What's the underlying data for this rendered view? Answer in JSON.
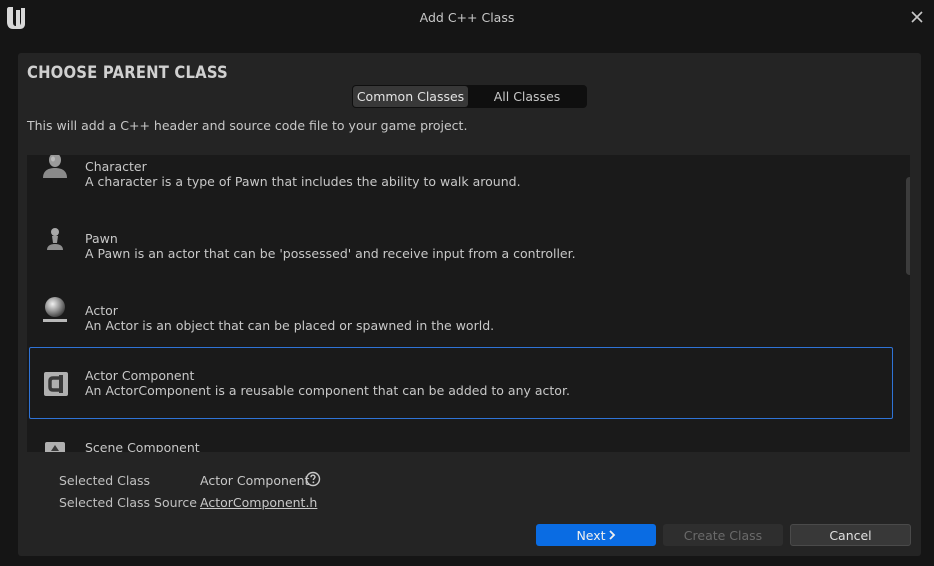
{
  "window": {
    "title": "Add C++ Class"
  },
  "header": {
    "heading": "CHOOSE PARENT CLASS",
    "tabs": [
      {
        "label": "Common Classes",
        "active": true
      },
      {
        "label": "All Classes",
        "active": false
      }
    ],
    "description": "This will add a C++ header and source code file to your game project."
  },
  "class_list": {
    "items": [
      {
        "name": "Character",
        "description": "A character is a type of Pawn that includes the ability to walk around.",
        "icon": "character-icon",
        "selected": false
      },
      {
        "name": "Pawn",
        "description": "A Pawn is an actor that can be 'possessed' and receive input from a controller.",
        "icon": "pawn-icon",
        "selected": false
      },
      {
        "name": "Actor",
        "description": "An Actor is an object that can be placed or spawned in the world.",
        "icon": "actor-icon",
        "selected": false
      },
      {
        "name": "Actor Component",
        "description": "An ActorComponent is a reusable component that can be added to any actor.",
        "icon": "actor-component-icon",
        "selected": true
      },
      {
        "name": "Scene Component",
        "description": "",
        "icon": "scene-component-icon",
        "selected": false
      }
    ]
  },
  "selection": {
    "class_label": "Selected Class",
    "class_value": "Actor Component",
    "source_label": "Selected Class Source",
    "source_value": "ActorComponent.h"
  },
  "buttons": {
    "next": "Next",
    "create": "Create Class",
    "cancel": "Cancel"
  },
  "colors": {
    "accent": "#0a6ce3",
    "selection_border": "#2f73d6",
    "background": "#151515",
    "panel": "#242424"
  }
}
